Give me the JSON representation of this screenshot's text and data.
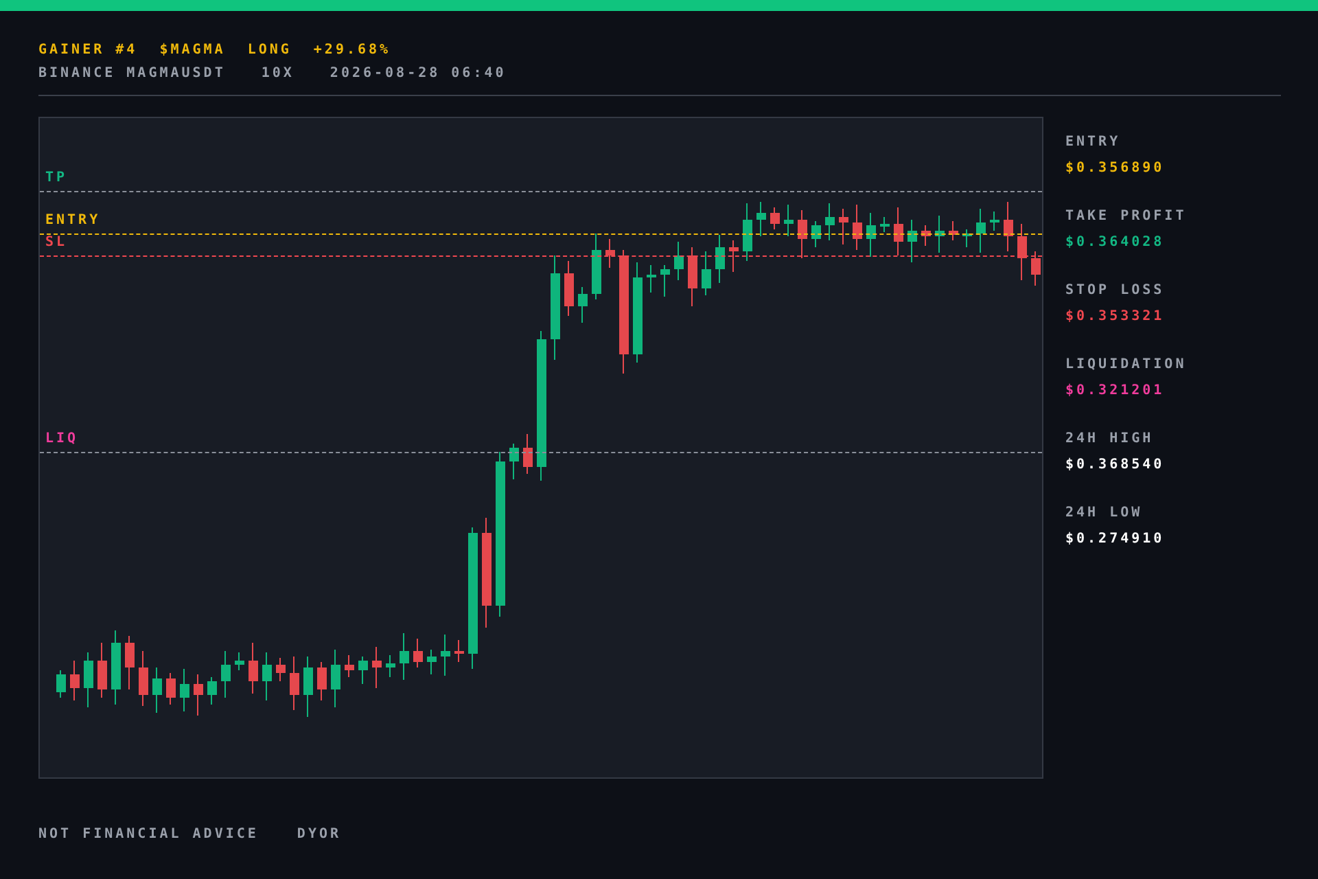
{
  "header": {
    "title": [
      "GAINER #4",
      "$MAGMA",
      "LONG",
      "+29.68%"
    ],
    "subtitle": [
      "BINANCE MAGMAUSDT",
      "10X",
      "2026-08-28 06:40"
    ]
  },
  "chart": {
    "price_lines": [
      {
        "label": "TP",
        "color": "#13b884"
      },
      {
        "label": "ENTRY",
        "color": "#f0b90b"
      },
      {
        "label": "SL",
        "color": "#f0474f"
      },
      {
        "label": "LIQ",
        "color": "#f03c9c"
      }
    ]
  },
  "stats": [
    {
      "label": "ENTRY",
      "value": "$0.356890",
      "color": "#f0b90b"
    },
    {
      "label": "TAKE PROFIT",
      "value": "$0.364028",
      "color": "#13b884"
    },
    {
      "label": "STOP LOSS",
      "value": "$0.353321",
      "color": "#f0474f"
    },
    {
      "label": "LIQUIDATION",
      "value": "$0.321201",
      "color": "#f03c9c"
    },
    {
      "label": "24H HIGH",
      "value": "$0.368540",
      "color": "#ffffff"
    },
    {
      "label": "24H LOW",
      "value": "$0.274910",
      "color": "#ffffff"
    }
  ],
  "footer": [
    "NOT FINANCIAL ADVICE",
    "DYOR"
  ]
}
